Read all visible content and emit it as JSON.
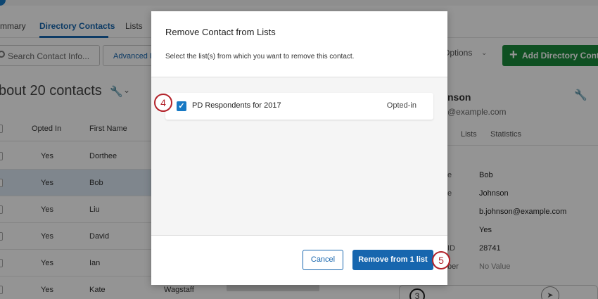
{
  "tabs": [
    "mmary",
    "Directory Contacts",
    "Lists"
  ],
  "search": {
    "placeholder": "Search Contact Info..."
  },
  "advanced_button": "Advanced F",
  "contacts_heading": "bout 20 contacts",
  "table": {
    "headers": [
      "Opted In",
      "First Name"
    ],
    "rows": [
      {
        "opted": "Yes",
        "first": "Dorthee"
      },
      {
        "opted": "Yes",
        "first": "Bob"
      },
      {
        "opted": "Yes",
        "first": "Liu"
      },
      {
        "opted": "Yes",
        "first": "David"
      },
      {
        "opted": "Yes",
        "first": "Ian"
      },
      {
        "opted": "Yes",
        "first": "Kate"
      }
    ],
    "extra_cell": "Wagstaff"
  },
  "toolbar": {
    "options": "Options",
    "add_button": "Add Directory Contac"
  },
  "right_panel": {
    "name": "nson",
    "email": "@example.com",
    "tabs": [
      "Lists",
      "Statistics"
    ],
    "fields": [
      {
        "label": "e",
        "value": "Bob"
      },
      {
        "label": "e",
        "value": "Johnson"
      },
      {
        "label": "",
        "value": "b.johnson@example.com"
      },
      {
        "label": "",
        "value": "Yes"
      },
      {
        "label": "ID",
        "value": "28741"
      },
      {
        "label": "ber",
        "value": "No Value"
      }
    ]
  },
  "bottom_card": {
    "number": "3"
  },
  "modal": {
    "title": "Remove Contact from Lists",
    "subtitle": "Select the list(s) from which you want to remove this contact.",
    "item": {
      "label": "PD Respondents for 2017",
      "status": "Opted-in",
      "checked": true
    },
    "cancel": "Cancel",
    "remove": "Remove from 1 list"
  },
  "callouts": [
    "4",
    "5"
  ],
  "colors": {
    "accent": "#1766ae",
    "green": "#1b8a3c",
    "callout": "#b3222a"
  }
}
